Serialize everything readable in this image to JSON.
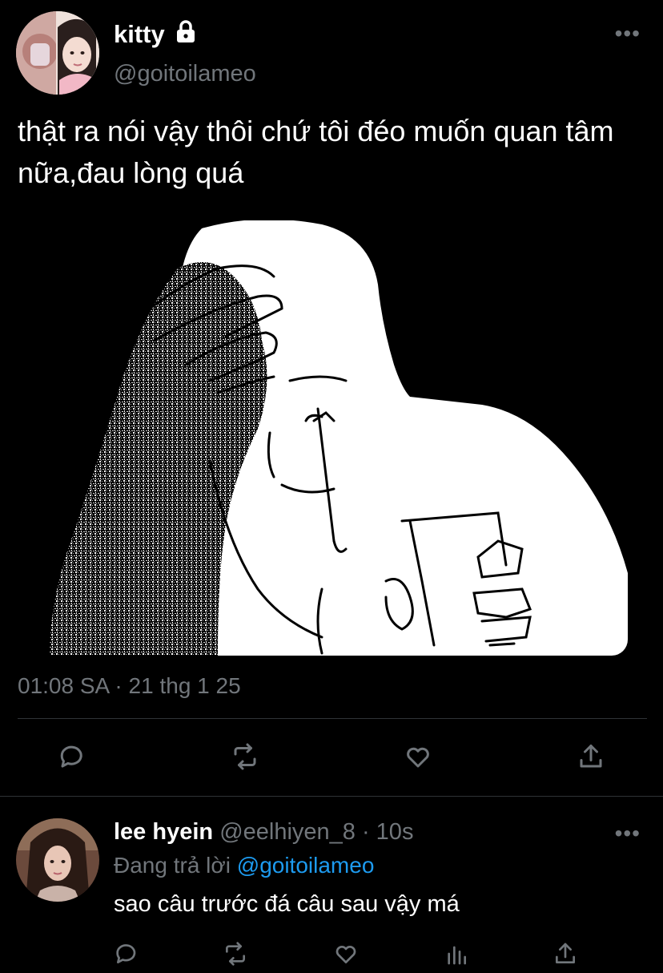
{
  "tweet": {
    "author_name": "kitty",
    "author_handle": "@goitoilameo",
    "text": "thật ra nói vậy thôi chứ tôi đéo muốn quan tâm nữa,đau lòng quá",
    "timestamp": "01:08 SA · 21 thg 1 25",
    "more_label": "•••",
    "icons": [
      "lock-icon",
      "reply-icon",
      "retweet-icon",
      "like-icon",
      "share-icon"
    ]
  },
  "reply": {
    "author_name": "lee hyein",
    "meta": "@eelhiyen_8 · 10s",
    "replying_prefix": "Đang trả lời",
    "replying_mention": "@goitoilameo",
    "text": "sao câu trước đá câu sau vậy má",
    "more_label": "•••",
    "icons": [
      "reply-icon",
      "retweet-icon",
      "like-icon",
      "views-icon",
      "share-icon"
    ]
  },
  "colors": {
    "background": "#000000",
    "text_primary": "#ffffff",
    "text_secondary": "#71767b",
    "accent": "#1d9bf0",
    "divider": "#2f3336"
  }
}
